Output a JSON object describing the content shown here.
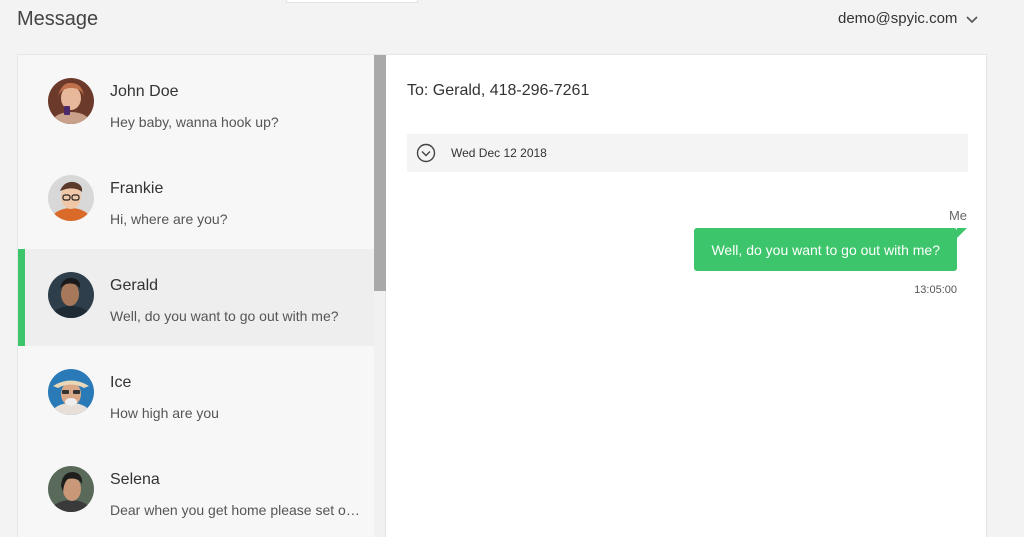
{
  "header": {
    "title": "Message",
    "account_email": "demo@spyic.com",
    "account_icon": "chevron-down-icon"
  },
  "contacts": [
    {
      "name": "John Doe",
      "preview": "Hey baby, wanna hook up?",
      "active": false
    },
    {
      "name": "Frankie",
      "preview": "Hi, where are you?",
      "active": false
    },
    {
      "name": "Gerald",
      "preview": "Well, do you want to go out with me?",
      "active": true
    },
    {
      "name": "Ice",
      "preview": "How high are you",
      "active": false
    },
    {
      "name": "Selena",
      "preview": "Dear when you get home please set out the trash",
      "active": false
    }
  ],
  "conversation": {
    "to_line": "To: Gerald, 418-296-7261",
    "date": "Wed Dec 12 2018",
    "date_icon": "chevron-circle-down-icon",
    "messages": [
      {
        "sender": "Me",
        "text": "Well, do you want to go out with me?",
        "time": "13:05:00"
      }
    ]
  },
  "colors": {
    "accent": "#3cc56a",
    "background": "#f3f3f3",
    "active_item": "#eeeeee"
  }
}
